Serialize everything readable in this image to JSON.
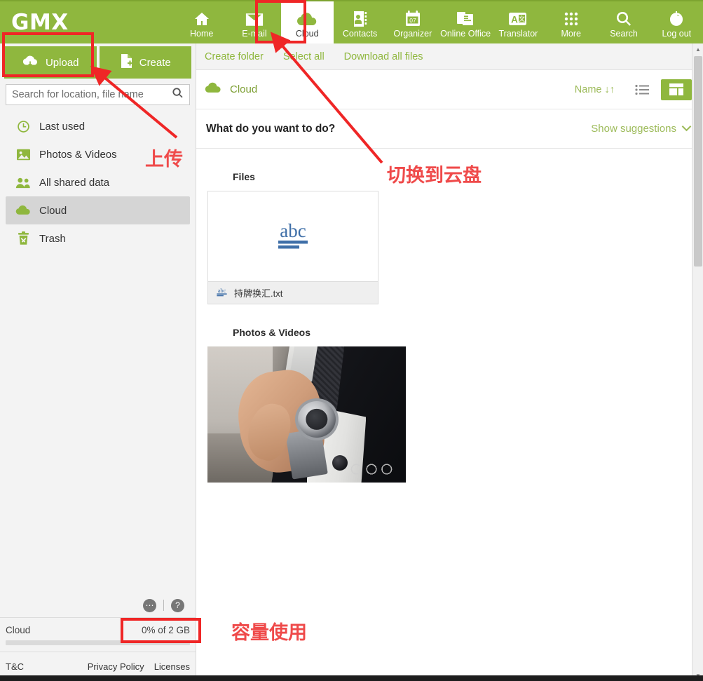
{
  "brand": {
    "logo": "GMX",
    "accent": "#8fb73e",
    "annotation_color": "#ef4a4a"
  },
  "topnav": {
    "items": [
      {
        "label": "Home",
        "icon": "home-icon",
        "active": false
      },
      {
        "label": "E-mail",
        "icon": "envelope-icon",
        "active": false
      },
      {
        "label": "Cloud",
        "icon": "cloud-icon",
        "active": true
      },
      {
        "label": "Contacts",
        "icon": "contacts-icon",
        "active": false
      },
      {
        "label": "Organizer",
        "icon": "calendar-icon",
        "badge": "07",
        "active": false
      },
      {
        "label": "Online Office",
        "icon": "documents-icon",
        "active": false
      },
      {
        "label": "Translator",
        "icon": "translator-icon",
        "active": false
      },
      {
        "label": "More",
        "icon": "grid-dots-icon",
        "active": false
      },
      {
        "label": "Search",
        "icon": "search-icon",
        "active": false
      },
      {
        "label": "Log out",
        "icon": "power-icon",
        "active": false
      }
    ]
  },
  "sidebar": {
    "upload_label": "Upload",
    "create_label": "Create",
    "search": {
      "placeholder": "Search for location, file name",
      "value": ""
    },
    "items": [
      {
        "label": "Last used",
        "icon": "clock-icon",
        "selected": false
      },
      {
        "label": "Photos & Videos",
        "icon": "image-icon",
        "selected": false
      },
      {
        "label": "All shared data",
        "icon": "people-icon",
        "selected": false
      },
      {
        "label": "Cloud",
        "icon": "cloud-icon",
        "selected": true
      },
      {
        "label": "Trash",
        "icon": "trash-icon",
        "selected": false
      }
    ],
    "chat_icon": "chat-bubble-icon",
    "help_icon": "help-question-icon",
    "storage": {
      "label": "Cloud",
      "usage": "0% of 2 GB",
      "percent": 0
    },
    "footer": {
      "tc": "T&C",
      "privacy": "Privacy Policy",
      "licenses": "Licenses"
    }
  },
  "main": {
    "toolbar": {
      "create_folder": "Create folder",
      "select_all": "Select all",
      "download_all": "Download all files"
    },
    "breadcrumb": {
      "label": "Cloud",
      "icon": "cloud-icon"
    },
    "sort_label": "Name ↓↑",
    "view_list_icon": "list-view-icon",
    "view_grid_icon": "grid-view-icon",
    "suggestions": {
      "question": "What do you want to do?",
      "link": "Show suggestions"
    },
    "sections": {
      "files_title": "Files",
      "photos_title": "Photos & Videos"
    },
    "files": [
      {
        "name": "持牌换汇.txt",
        "icon": "abc-text-file-icon",
        "type": "txt"
      }
    ],
    "photos": [
      {
        "alt": "Person in suit checking wristwatch",
        "name": "photo-thumbnail"
      }
    ]
  },
  "annotations": [
    {
      "id": "upload-box",
      "type": "box"
    },
    {
      "id": "cloud-tab-box",
      "type": "box"
    },
    {
      "id": "storage-box",
      "type": "box"
    },
    {
      "id": "upload-label",
      "type": "text",
      "text": "上传"
    },
    {
      "id": "switch-to-cloud-label",
      "type": "text",
      "text": "切换到云盘"
    },
    {
      "id": "capacity-label",
      "type": "text",
      "text": "容量使用"
    }
  ]
}
